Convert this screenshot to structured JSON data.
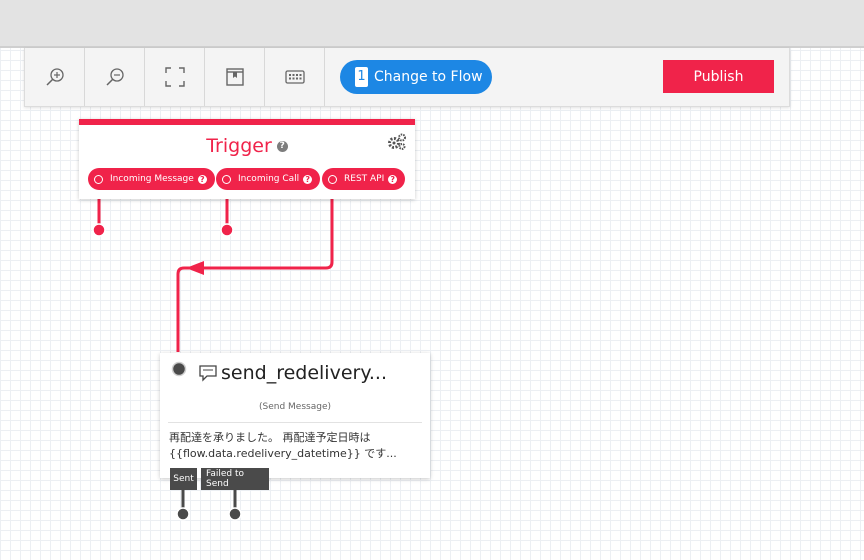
{
  "toolbar": {
    "tools": [
      {
        "icon": "zoom-in-icon"
      },
      {
        "icon": "zoom-out-icon"
      },
      {
        "icon": "fit-screen-icon"
      },
      {
        "icon": "bookmark-icon"
      },
      {
        "icon": "keyboard-icon"
      }
    ],
    "flow_button": {
      "number": "1",
      "label": "Change to Flow"
    },
    "publish_label": "Publish"
  },
  "trigger": {
    "title": "Trigger",
    "help": "?",
    "pills": [
      {
        "label": "Incoming Message",
        "help": "?"
      },
      {
        "label": "Incoming Call",
        "help": "?"
      },
      {
        "label": "REST API",
        "help": "?"
      }
    ]
  },
  "send_node": {
    "title": "send_redelivery...",
    "subtitle": "(Send Message)",
    "body_line1": "再配達を承りました。 再配達予定日時は",
    "body_line2": "{{flow.data.redelivery_datetime}} です...",
    "outputs": [
      {
        "label": "Sent"
      },
      {
        "label": "Failed to Send"
      }
    ]
  },
  "colors": {
    "accent_red": "#f0234a",
    "flow_blue": "#1d87e4",
    "node_dark": "#4a4a4a"
  }
}
